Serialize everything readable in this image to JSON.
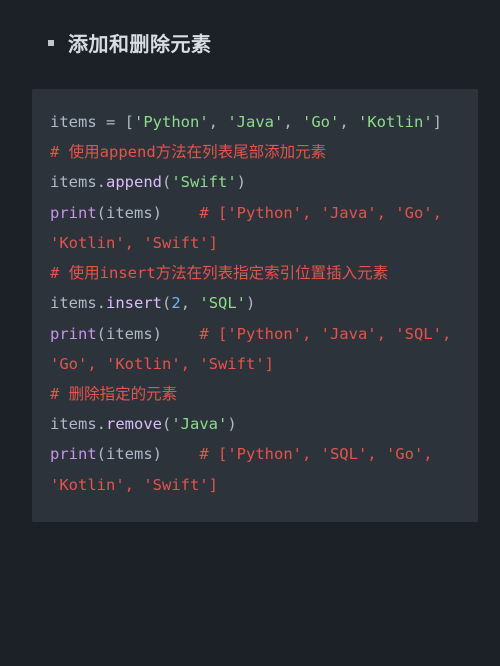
{
  "heading": "添加和删除元素",
  "code": {
    "l01_items": "items",
    "l01_eq": " = ",
    "l01_br1": "[",
    "l01_s1": "'Python'",
    "l01_c1": ", ",
    "l01_s2": "'Java'",
    "l01_c2": ", ",
    "l01_s3": "'Go'",
    "l01_c3": ", ",
    "l01_s4": "'Kotlin'",
    "l01_br2": "]",
    "l02_cmt": "# 使用append方法在列表尾部添加元素",
    "l03_obj": "items.",
    "l03_fn": "append",
    "l03_p1": "(",
    "l03_arg": "'Swift'",
    "l03_p2": ")",
    "l04_print": "print",
    "l04_p1": "(items)    ",
    "l04_cmt": "# ['Python', 'Java', 'Go', 'Kotlin', 'Swift']",
    "l05_cmt": "# 使用insert方法在列表指定索引位置插入元素",
    "l06_obj": "items.",
    "l06_fn": "insert",
    "l06_p1": "(",
    "l06_num": "2",
    "l06_c": ", ",
    "l06_str": "'SQL'",
    "l06_p2": ")",
    "l07_print": "print",
    "l07_p1": "(items)    ",
    "l07_cmt": "# ['Python', 'Java', 'SQL', 'Go', 'Kotlin', 'Swift']",
    "l08_cmt": "# 删除指定的元素",
    "l09_obj": "items.",
    "l09_fn": "remove",
    "l09_p1": "(",
    "l09_str": "'Java'",
    "l09_p2": ")",
    "l10_print": "print",
    "l10_p1": "(items)    ",
    "l10_cmt": "# ['Python', 'SQL', 'Go', 'Kotlin', 'Swift']"
  }
}
